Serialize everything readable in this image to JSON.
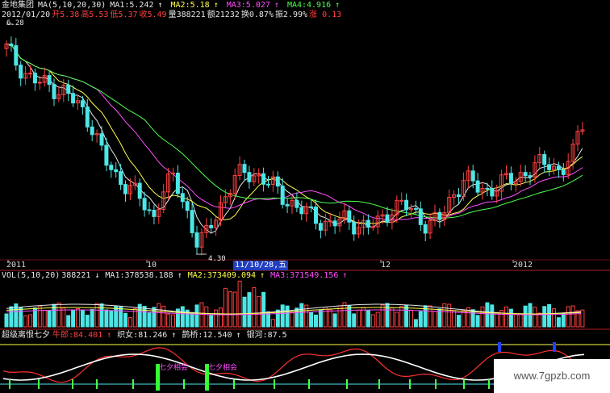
{
  "header": {
    "stock_name": "金地集团",
    "ma_params": "MA(5,10,20,30)",
    "ma_values": [
      {
        "label": "MA1:5.242",
        "arrow": "↑",
        "color": "#e6e6e6"
      },
      {
        "label": "MA2:5.18",
        "arrow": "↑",
        "color": "#ffff4d"
      },
      {
        "label": "MA3:5.027",
        "arrow": "↑",
        "color": "#ff4dff"
      },
      {
        "label": "MA4:4.916",
        "arrow": "↑",
        "color": "#4dff4d"
      }
    ]
  },
  "quote": {
    "date": "2012/01/20",
    "open": "开5.38",
    "high": "高5.53",
    "low": "低5.37",
    "close": "收5.49",
    "volume": "量388221",
    "amount": "额21232",
    "turnover": "换0.87%",
    "amplitude": "振2.99%",
    "change": "涨 0.13"
  },
  "price_chart": {
    "high_label": "6.28",
    "low_label": "4.30"
  },
  "time_axis": {
    "labels": [
      "2011",
      "10",
      "12",
      "2012"
    ],
    "cursor_date": "11/10/28,五"
  },
  "volume_header": {
    "params": "VOL(5,10,20)",
    "value": "388221",
    "value_arrow": "↓",
    "ma1": "MA1:378538.188",
    "ma1_arrow": "↑",
    "ma2": "MA2:373409.094",
    "ma2_arrow": "↑",
    "ma3": "MA3:371549.156",
    "ma3_arrow": "↑"
  },
  "indicator_header": {
    "name": "超级离恨七夕",
    "niulang": "牛郎:84.401",
    "niulang_arrow": "↑",
    "zhinv": "织女:81.246",
    "zhinv_arrow": "↑",
    "queqiao": "鹊桥:12.540",
    "queqiao_arrow": "↑",
    "yinhe": "银河:87.5"
  },
  "indicator": {
    "signal_label": "七夕相会"
  },
  "watermark": "www.7gpzb.com",
  "colors": {
    "up": "#ff4040",
    "down": "#4de6e6",
    "ma1": "#e6e6e6",
    "ma2": "#ffff4d",
    "ma3": "#ff4dff",
    "ma4": "#4dff4d",
    "panel_border": "#b02020"
  }
}
